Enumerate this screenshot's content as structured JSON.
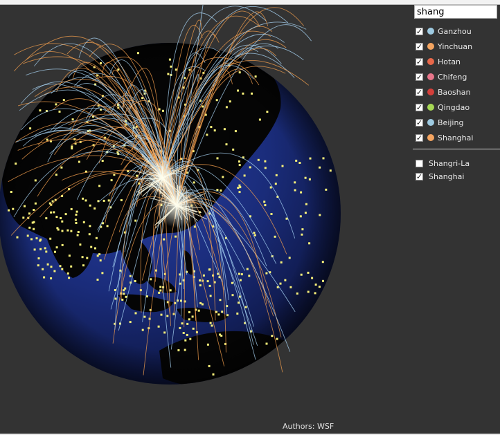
{
  "search": {
    "value": "shang",
    "placeholder": ""
  },
  "cities": [
    {
      "label": "Ganzhou",
      "checked": true,
      "color": "#9ecae1"
    },
    {
      "label": "Yinchuan",
      "checked": true,
      "color": "#f4a460"
    },
    {
      "label": "Hotan",
      "checked": true,
      "color": "#e8684a"
    },
    {
      "label": "Chifeng",
      "checked": true,
      "color": "#e8758a"
    },
    {
      "label": "Baoshan",
      "checked": true,
      "color": "#d43f3a"
    },
    {
      "label": "Qingdao",
      "checked": true,
      "color": "#a6d854"
    },
    {
      "label": "Beijing",
      "checked": true,
      "color": "#9ecae1"
    },
    {
      "label": "Shanghai",
      "checked": true,
      "color": "#f4a460"
    }
  ],
  "search_results": [
    {
      "label": "Shangri-La",
      "checked": false
    },
    {
      "label": "Shanghai",
      "checked": true
    }
  ],
  "footer": {
    "authors": "Authors: WSF"
  },
  "colors": {
    "background": "#333333",
    "ocean": "#1a2c7a",
    "land": "#050505",
    "city_dot": "#f7f07a",
    "route_warm": "#f6a04d",
    "route_cool": "#a9d6f5"
  }
}
